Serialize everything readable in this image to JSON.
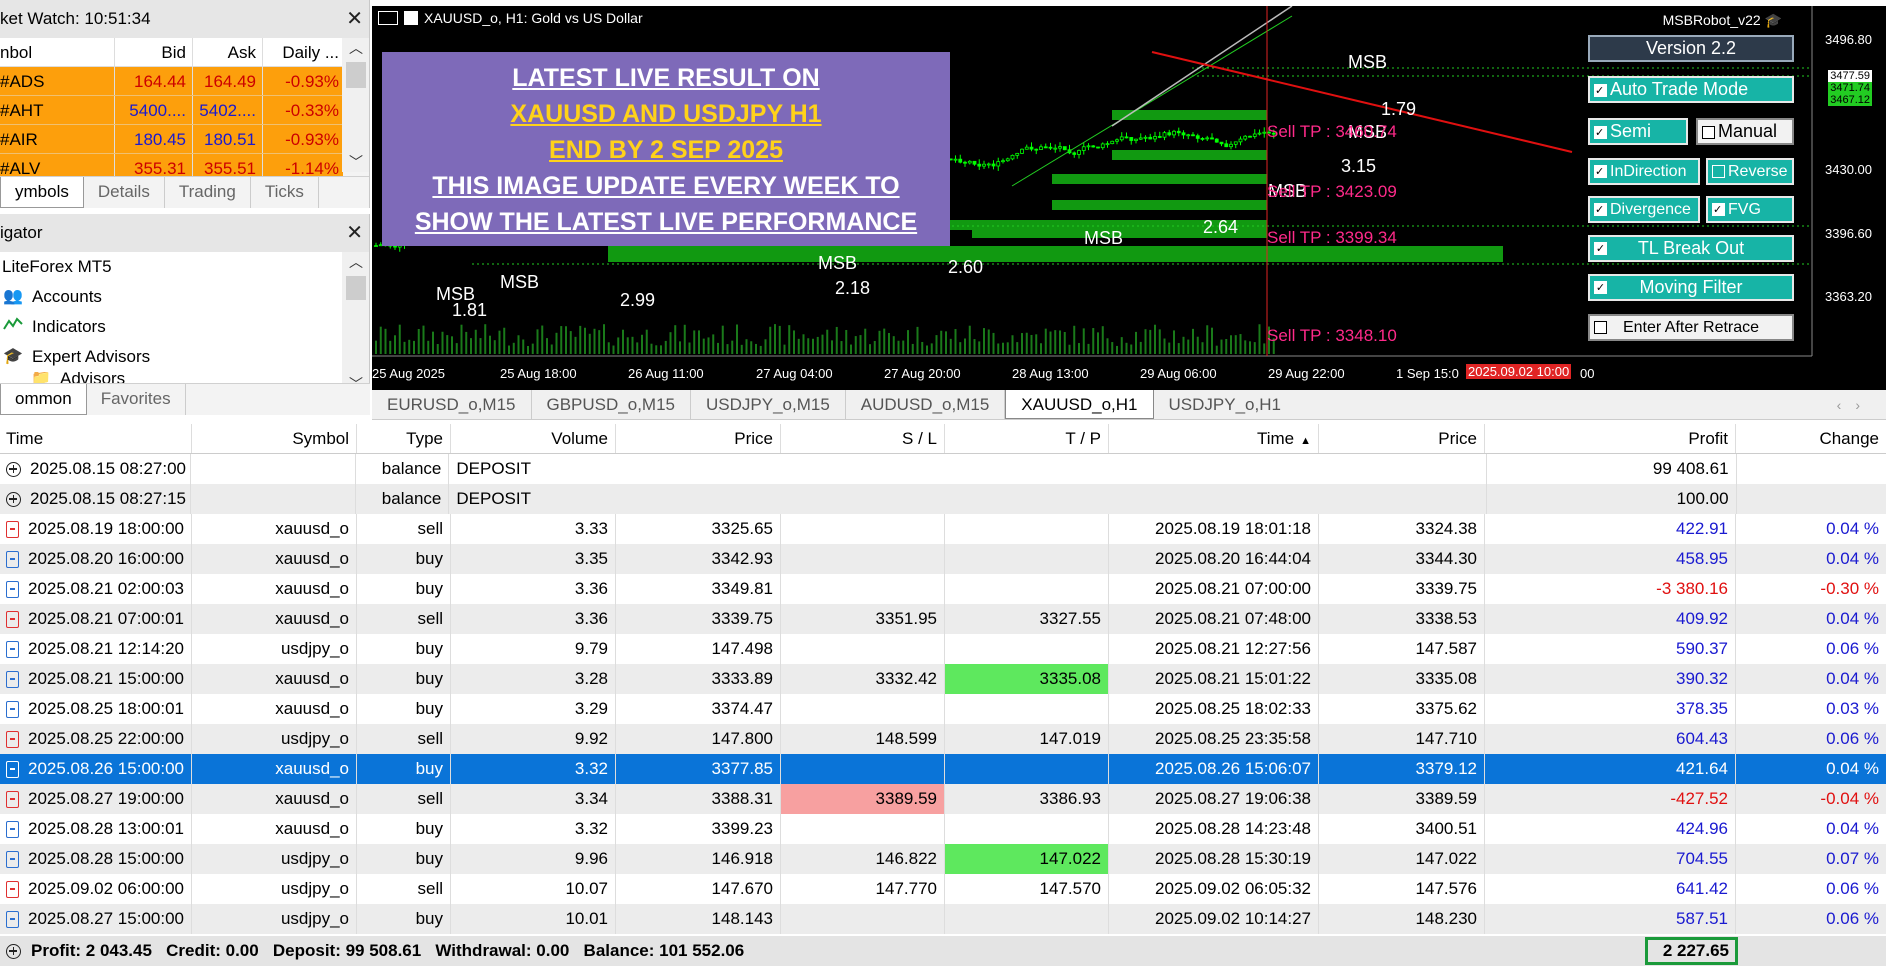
{
  "market_watch": {
    "title": "ket Watch: 10:51:34",
    "columns": [
      "nbol",
      "Bid",
      "Ask",
      "Daily ..."
    ],
    "rows": [
      {
        "symbol": "#ADS",
        "bid": "164.44",
        "ask": "164.49",
        "daily": "-0.93%"
      },
      {
        "symbol": "#AHT",
        "bid": "5400....",
        "ask": "5402....",
        "daily": "-0.33%"
      },
      {
        "symbol": "#AIR",
        "bid": "180.45",
        "ask": "180.51",
        "daily": "-0.93%"
      },
      {
        "symbol": "#ALV",
        "bid": "355.31",
        "ask": "355.51",
        "daily": "-1.14%"
      }
    ],
    "tabs": [
      "ymbols",
      "Details",
      "Trading",
      "Ticks"
    ]
  },
  "navigator": {
    "title": "igator",
    "items": [
      "LiteForex MT5",
      "Accounts",
      "Indicators",
      "Expert Advisors",
      "Advisors"
    ],
    "tabs": [
      "ommon",
      "Favorites"
    ]
  },
  "chart": {
    "title": "XAUUSD_o, H1:  Gold vs US Dollar",
    "robot": "MSBRobot_v22",
    "promo_lines": [
      {
        "text": "LATEST LIVE RESULT ON",
        "color": "white"
      },
      {
        "text": "XAUUSD AND USDJPY H1",
        "color": "yellow"
      },
      {
        "text": "END BY 2 SEP 2025",
        "color": "yellow"
      },
      {
        "text": "THIS IMAGE UPDATE EVERY WEEK TO",
        "color": "white"
      },
      {
        "text": "SHOW THE LATEST LIVE PERFORMANCE",
        "color": "white"
      }
    ],
    "buttons": {
      "version": "Version 2.2",
      "auto_trade": "Auto Trade Mode",
      "semi": "Semi",
      "manual": "Manual",
      "in_direction": "InDirection",
      "reverse": "Reverse",
      "divergence": "Divergence",
      "fvg": "FVG",
      "tl_break": "TL Break Out",
      "moving_filter": "Moving Filter",
      "enter_after": "Enter After Retrace"
    },
    "sell_tp": [
      "Sell TP : 3460.74",
      "Sell TP : 3423.09",
      "Sell TP : 3399.34",
      "Sell TP : 3348.10"
    ],
    "price_labels": [
      "3496.80",
      "3477.59",
      "3471.74",
      "3467.12",
      "3430.00",
      "3396.60",
      "3363.20"
    ],
    "time_labels": [
      "25 Aug 2025",
      "25 Aug 18:00",
      "26 Aug 11:00",
      "27 Aug 04:00",
      "27 Aug 20:00",
      "28 Aug 13:00",
      "29 Aug 06:00",
      "29 Aug 22:00",
      "1 Sep 15:0",
      "00"
    ],
    "time_highlight": "2025.09.02 10:00",
    "annotations": [
      "MSB",
      "MSB",
      "1.81",
      "2.99",
      "MSB",
      "2.18",
      "2.60",
      "MSB",
      "2.64",
      "MSB",
      "3.15",
      "MSB",
      "MSB",
      "1.79"
    ],
    "colors": {
      "bull": "#00ff00",
      "zone": "#119911",
      "background": "#000000"
    }
  },
  "chart_tabs": [
    "EURUSD_o,M15",
    "GBPUSD_o,M15",
    "USDJPY_o,M15",
    "AUDUSD_o,M15",
    "XAUUSD_o,H1",
    "USDJPY_o,H1"
  ],
  "history": {
    "columns": [
      "Time",
      "Symbol",
      "Type",
      "Volume",
      "Price",
      "S / L",
      "T / P",
      "Time",
      "Price",
      "Profit",
      "Change"
    ],
    "rows": [
      {
        "kind": "bal",
        "time": "2025.08.15 08:27:00",
        "symbol": "",
        "type": "balance",
        "comment": "DEPOSIT",
        "profit": "99 408.61"
      },
      {
        "kind": "bal",
        "time": "2025.08.15 08:27:15",
        "symbol": "",
        "type": "balance",
        "comment": "DEPOSIT",
        "profit": "100.00"
      },
      {
        "kind": "sell",
        "time": "2025.08.19 18:00:00",
        "symbol": "xauusd_o",
        "type": "sell",
        "volume": "3.33",
        "price": "3325.65",
        "sl": "",
        "tp": "",
        "time2": "2025.08.19 18:01:18",
        "price2": "3324.38",
        "profit": "422.91",
        "change": "0.04 %"
      },
      {
        "kind": "buy",
        "time": "2025.08.20 16:00:00",
        "symbol": "xauusd_o",
        "type": "buy",
        "volume": "3.35",
        "price": "3342.93",
        "sl": "",
        "tp": "",
        "time2": "2025.08.20 16:44:04",
        "price2": "3344.30",
        "profit": "458.95",
        "change": "0.04 %"
      },
      {
        "kind": "buy",
        "time": "2025.08.21 02:00:03",
        "symbol": "xauusd_o",
        "type": "buy",
        "volume": "3.36",
        "price": "3349.81",
        "sl": "",
        "tp": "",
        "time2": "2025.08.21 07:00:00",
        "price2": "3339.75",
        "profit": "-3 380.16",
        "change": "-0.30 %"
      },
      {
        "kind": "sell",
        "time": "2025.08.21 07:00:01",
        "symbol": "xauusd_o",
        "type": "sell",
        "volume": "3.36",
        "price": "3339.75",
        "sl": "3351.95",
        "tp": "3327.55",
        "time2": "2025.08.21 07:48:00",
        "price2": "3338.53",
        "profit": "409.92",
        "change": "0.04 %"
      },
      {
        "kind": "buy",
        "time": "2025.08.21 12:14:20",
        "symbol": "usdjpy_o",
        "type": "buy",
        "volume": "9.79",
        "price": "147.498",
        "sl": "",
        "tp": "",
        "time2": "2025.08.21 12:27:56",
        "price2": "147.587",
        "profit": "590.37",
        "change": "0.06 %"
      },
      {
        "kind": "buy",
        "time": "2025.08.21 15:00:00",
        "symbol": "xauusd_o",
        "type": "buy",
        "volume": "3.28",
        "price": "3333.89",
        "sl": "3332.42",
        "tp": "3335.08",
        "tp_hl": "green",
        "time2": "2025.08.21 15:01:22",
        "price2": "3335.08",
        "profit": "390.32",
        "change": "0.04 %"
      },
      {
        "kind": "buy",
        "time": "2025.08.25 18:00:01",
        "symbol": "xauusd_o",
        "type": "buy",
        "volume": "3.29",
        "price": "3374.47",
        "sl": "",
        "tp": "",
        "time2": "2025.08.25 18:02:33",
        "price2": "3375.62",
        "profit": "378.35",
        "change": "0.03 %"
      },
      {
        "kind": "sell",
        "time": "2025.08.25 22:00:00",
        "symbol": "usdjpy_o",
        "type": "sell",
        "volume": "9.92",
        "price": "147.800",
        "sl": "148.599",
        "tp": "147.019",
        "time2": "2025.08.25 23:35:58",
        "price2": "147.710",
        "profit": "604.43",
        "change": "0.06 %"
      },
      {
        "kind": "buy",
        "selected": true,
        "time": "2025.08.26 15:00:00",
        "symbol": "xauusd_o",
        "type": "buy",
        "volume": "3.32",
        "price": "3377.85",
        "sl": "",
        "tp": "",
        "time2": "2025.08.26 15:06:07",
        "price2": "3379.12",
        "profit": "421.64",
        "change": "0.04 %"
      },
      {
        "kind": "sell",
        "time": "2025.08.27 19:00:00",
        "symbol": "xauusd_o",
        "type": "sell",
        "volume": "3.34",
        "price": "3388.31",
        "sl": "3389.59",
        "sl_hl": "red",
        "tp": "3386.93",
        "time2": "2025.08.27 19:06:38",
        "price2": "3389.59",
        "profit": "-427.52",
        "change": "-0.04 %"
      },
      {
        "kind": "buy",
        "time": "2025.08.28 13:00:01",
        "symbol": "xauusd_o",
        "type": "buy",
        "volume": "3.32",
        "price": "3399.23",
        "sl": "",
        "tp": "",
        "time2": "2025.08.28 14:23:48",
        "price2": "3400.51",
        "profit": "424.96",
        "change": "0.04 %"
      },
      {
        "kind": "buy",
        "time": "2025.08.28 15:00:00",
        "symbol": "usdjpy_o",
        "type": "buy",
        "volume": "9.96",
        "price": "146.918",
        "sl": "146.822",
        "tp": "147.022",
        "tp_hl": "green",
        "time2": "2025.08.28 15:30:19",
        "price2": "147.022",
        "profit": "704.55",
        "change": "0.07 %"
      },
      {
        "kind": "sell",
        "time": "2025.09.02 06:00:00",
        "symbol": "usdjpy_o",
        "type": "sell",
        "volume": "10.07",
        "price": "147.670",
        "sl": "147.770",
        "tp": "147.570",
        "time2": "2025.09.02 06:05:32",
        "price2": "147.576",
        "profit": "641.42",
        "change": "0.06 %"
      },
      {
        "kind": "buy",
        "time": "2025.08.27 15:00:00",
        "symbol": "usdjpy_o",
        "type": "buy",
        "volume": "10.01",
        "price": "148.143",
        "sl": "",
        "tp": "",
        "time2": "2025.09.02 10:14:27",
        "price2": "148.230",
        "profit": "587.51",
        "change": "0.06 %"
      }
    ],
    "footer": {
      "summary": "Profit: 2 043.45   Credit: 0.00   Deposit: 99 508.61   Withdrawal: 0.00   Balance: 101 552.06",
      "total": "2 227.65"
    }
  }
}
